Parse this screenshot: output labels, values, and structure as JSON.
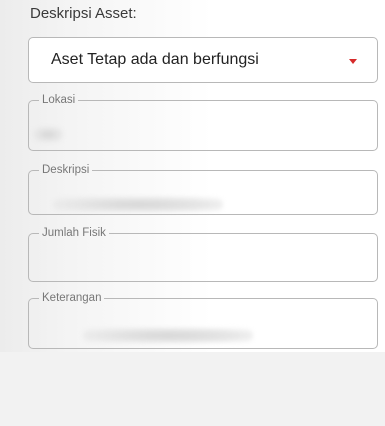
{
  "section": {
    "label": "Deskripsi Asset:"
  },
  "dropdown": {
    "selected": "Aset Tetap ada dan berfungsi",
    "caret_color": "#d62a2a"
  },
  "fields": {
    "lokasi": {
      "label": "Lokasi"
    },
    "deskripsi": {
      "label": "Deskripsi"
    },
    "jumlah_fisik": {
      "label": "Jumlah Fisik"
    },
    "keterangan": {
      "label": "Keterangan"
    }
  }
}
